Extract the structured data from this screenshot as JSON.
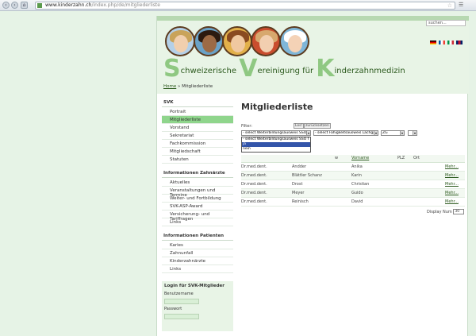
{
  "browser": {
    "url_host": "www.kinderzahn.ch",
    "url_path": "/index.php/de/mitgliederliste"
  },
  "header": {
    "search_placeholder": "suchen...",
    "title_parts": [
      {
        "big": "S",
        "rest": "chweizerische "
      },
      {
        "big": "V",
        "rest": "ereinigung für "
      },
      {
        "big": "K",
        "rest": "inderzahnmedizin"
      }
    ],
    "flags": [
      {
        "name": "de-flag",
        "colors": [
          "#000000",
          "#dd0000",
          "#ffce00"
        ]
      },
      {
        "name": "fr-flag",
        "colors": [
          "#0055a4",
          "#ffffff",
          "#ef4135"
        ]
      },
      {
        "name": "it-flag",
        "colors": [
          "#009246",
          "#ffffff",
          "#ce2b37"
        ]
      },
      {
        "name": "en-flag",
        "colors": [
          "#012169",
          "#c8102e",
          "#012169"
        ]
      }
    ]
  },
  "breadcrumb": {
    "home": "Home",
    "sep": " » ",
    "current": "Mitgliederliste"
  },
  "sidebar": {
    "sections": [
      {
        "heading": "SVK",
        "items": [
          "Portrait",
          "Mitgliederliste",
          "Vorstand",
          "Sekretariat",
          "Fachkommission",
          "Mitgliedschaft",
          "Statuten"
        ]
      },
      {
        "heading": "Informationen Zahnärzte",
        "items": [
          "Aktuelles",
          "Veranstaltungen und Termine",
          "Weiter- und Fortbildung",
          "SVK-ASP-Award",
          "Versicherung- und Tariffragen",
          "Links"
        ]
      },
      {
        "heading": "Informationen Patienten",
        "items": [
          "Karies",
          "Zahnunfall",
          "Kinderzahnärzte",
          "Links"
        ]
      }
    ],
    "active_item": "Mitgliederliste",
    "login": {
      "heading": "Login für SVK-Mitglieder",
      "username_label": "Benutzername",
      "password_label": "Passwort"
    }
  },
  "main": {
    "title": "Mitgliederliste",
    "filter": {
      "label": "Filter:",
      "btn_go": "Los!",
      "btn_reset": "zurücksetzen",
      "select1": "- select Weiterbildungsausweis SSO f",
      "select2": "- select Fähigkeitsausweis Lachgas",
      "select3": "ZG",
      "select4": "",
      "dropdown_options": [
        "- select Weiterbildungsausweis SSO f",
        "ja",
        "nein"
      ],
      "dropdown_highlighted": 1
    },
    "table": {
      "headers": [
        "Titel",
        "Name",
        "Vorname",
        "PLZ",
        "Ort",
        ""
      ],
      "header_name_visible": "w",
      "rows": [
        [
          "Dr.med.dent.",
          "Andder",
          "Anika",
          "",
          "",
          "Mehr..."
        ],
        [
          "Dr.med.dent.",
          "Blättler Schanz",
          "Karin",
          "",
          "",
          "Mehr..."
        ],
        [
          "Dr.med.dent.",
          "Drost",
          "Christian",
          "",
          "",
          "Mehr..."
        ],
        [
          "Dr.med.dent.",
          "Meyer",
          "Guido",
          "",
          "",
          "Mehr..."
        ],
        [
          "Dr.med.dent.",
          "Reinisch",
          "David",
          "",
          "",
          "Mehr..."
        ]
      ]
    },
    "display_num": {
      "label": "Display Num",
      "value": "30"
    }
  }
}
